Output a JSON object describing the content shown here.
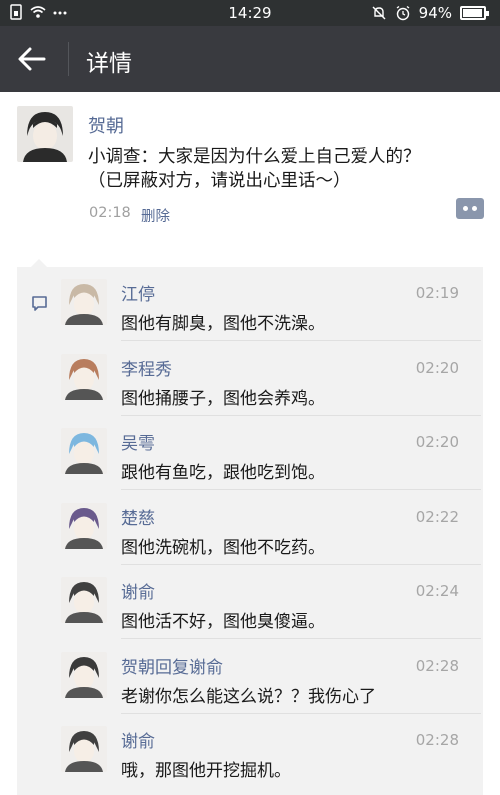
{
  "status_bar": {
    "time": "14:29",
    "battery": "94%",
    "battery_level": 0.94
  },
  "header": {
    "title": "详情"
  },
  "post": {
    "author": "贺朝",
    "text_line1": "小调查：大家是因为什么爱上自己爱人的？",
    "text_line2": "（已屏蔽对方，请说出心里话～）",
    "time": "02:18",
    "delete_label": "删除"
  },
  "comments": [
    {
      "name": "江停",
      "text": "图他有脚臭，图他不洗澡。",
      "time": "02:19",
      "avatar_color": "#c9b9a6"
    },
    {
      "name": "李程秀",
      "text": "图他捅腰子，图他会养鸡。",
      "time": "02:20",
      "avatar_color": "#b87d5e"
    },
    {
      "name": "吴雩",
      "text": "跟他有鱼吃，跟他吃到饱。",
      "time": "02:20",
      "avatar_color": "#7db7df"
    },
    {
      "name": "楚慈",
      "text": "图他洗碗机，图他不吃药。",
      "time": "02:22",
      "avatar_color": "#6a5a8c"
    },
    {
      "name": "谢俞",
      "text": "图他活不好，图他臭傻逼。",
      "time": "02:24",
      "avatar_color": "#404040"
    },
    {
      "name": "贺朝",
      "reply_word": "回复",
      "reply_to": "谢俞",
      "text": "老谢你怎么能这么说？？我伤心了",
      "time": "02:28",
      "avatar_color": "#3a3a3a"
    },
    {
      "name": "谢俞",
      "text": "哦，那图他开挖掘机。",
      "time": "02:28",
      "avatar_color": "#404040"
    }
  ]
}
